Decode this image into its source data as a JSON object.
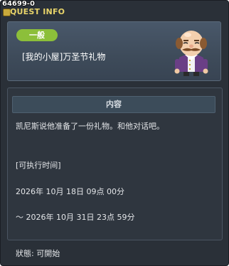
{
  "window": {
    "quest_id": "64699-0",
    "title": "QUEST INFO"
  },
  "header": {
    "badge": "一般",
    "quest_title": "[我的小屋]万圣节礼物"
  },
  "content": {
    "heading": "内容",
    "description": "凯尼斯说他准备了一份礼物。和他对话吧。",
    "time_label": "[可执行时间]",
    "start_time": "2026年 10月 18日 09点 00分",
    "end_time": "～ 2026年 10月 31日 23点 59分"
  },
  "status": {
    "text": "狀態: 可開始"
  },
  "colors": {
    "badge_green": "#8cbf3a",
    "title_yellow": "#e8d46a",
    "window_bg": "#2a3038"
  },
  "icons": {
    "npc": "npc-portrait-icon"
  }
}
